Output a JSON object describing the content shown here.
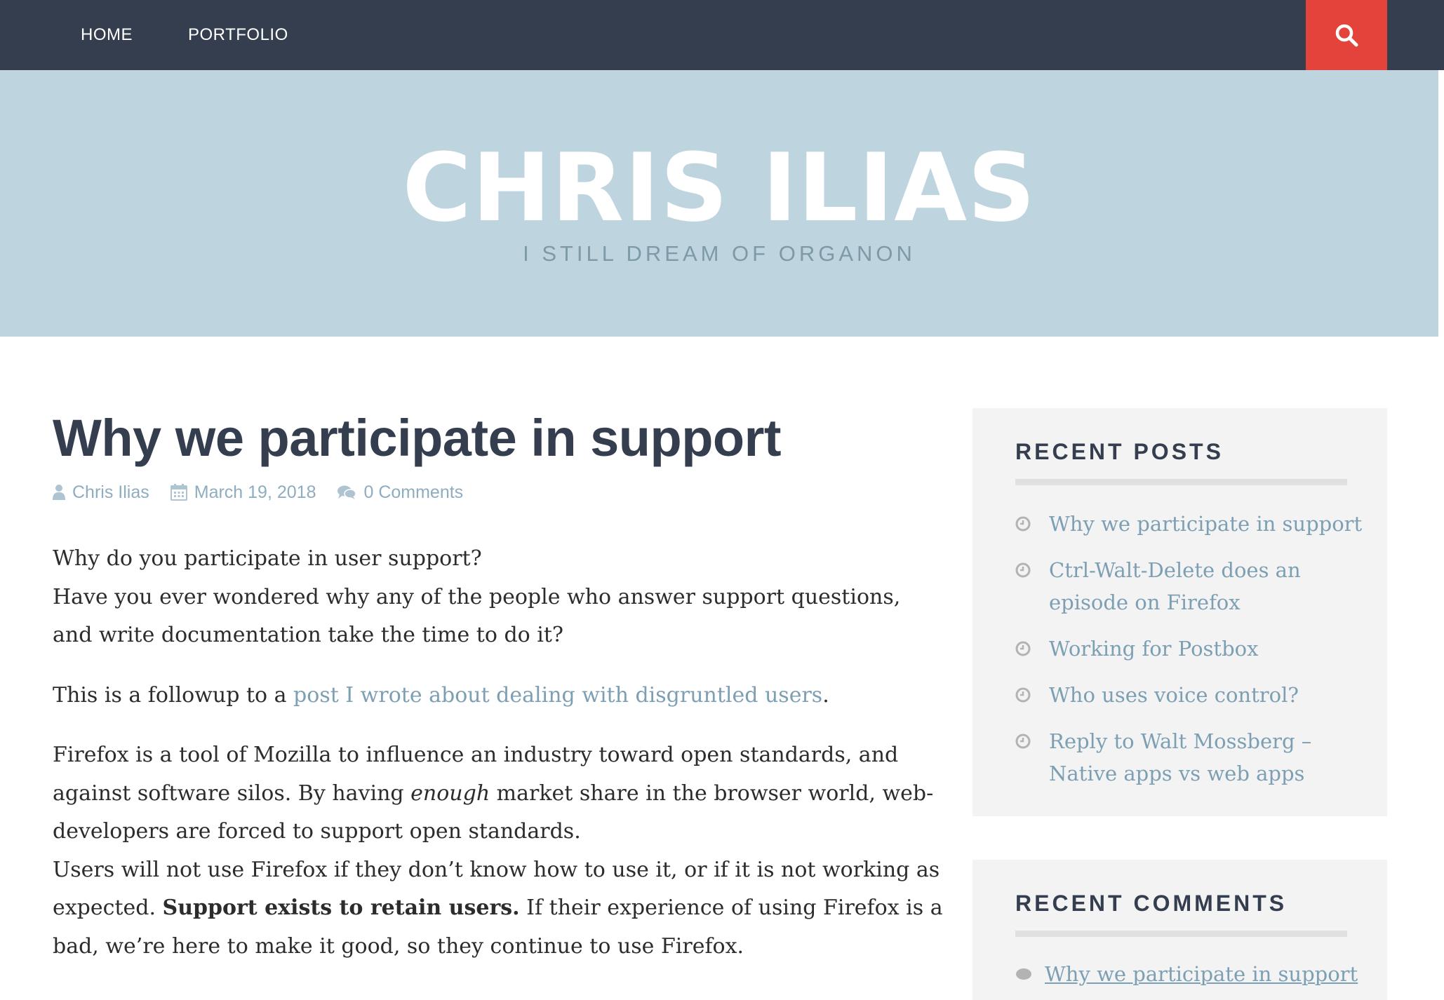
{
  "nav": {
    "home": "HOME",
    "portfolio": "PORTFOLIO",
    "search_icon": "search-icon"
  },
  "header": {
    "title": "CHRIS ILIAS",
    "tagline": "I STILL DREAM OF ORGANON"
  },
  "post": {
    "title": "Why we participate in support",
    "author": "Chris Ilias",
    "date": "March 19, 2018",
    "comments": "0 Comments",
    "p1_line1": "Why do you participate in user support?",
    "p1_line2": "Have you ever wondered why any of the people who answer support questions, and write documentation take the time to do it?",
    "p2_before": "This is a followup to a ",
    "p2_link": "post I wrote about dealing with disgruntled users",
    "p2_after": ".",
    "p3_a": "Firefox is a tool of Mozilla to influence an industry toward open standards, and against software silos. By having ",
    "p3_em": "enough",
    "p3_b": " market share in the browser world, web-developers are forced to support open standards.",
    "p3_c": "Users will not use Firefox if they don’t know how to use it, or if it is not working as expected. ",
    "p3_bold": "Support exists to retain users.",
    "p3_d": " If their experience of using Firefox is a bad, we’re here to make it good, so they continue to use Firefox."
  },
  "sidebar": {
    "recent_posts": {
      "title": "RECENT POSTS",
      "items": [
        "Why we participate in support",
        "Ctrl-Walt-Delete does an episode on Firefox",
        "Working for Postbox",
        "Who uses voice control?",
        "Reply to Walt Mossberg – Native apps vs web apps"
      ]
    },
    "recent_comments": {
      "title": "RECENT COMMENTS",
      "items": [
        "Why we participate in support"
      ]
    }
  },
  "colors": {
    "nav_bg": "#343e4f",
    "search_bg": "#e3433a",
    "banner_bg": "#bed4df",
    "link": "#7d9fb3",
    "heading": "#343e4f",
    "widget_bg": "#f3f3f3"
  }
}
